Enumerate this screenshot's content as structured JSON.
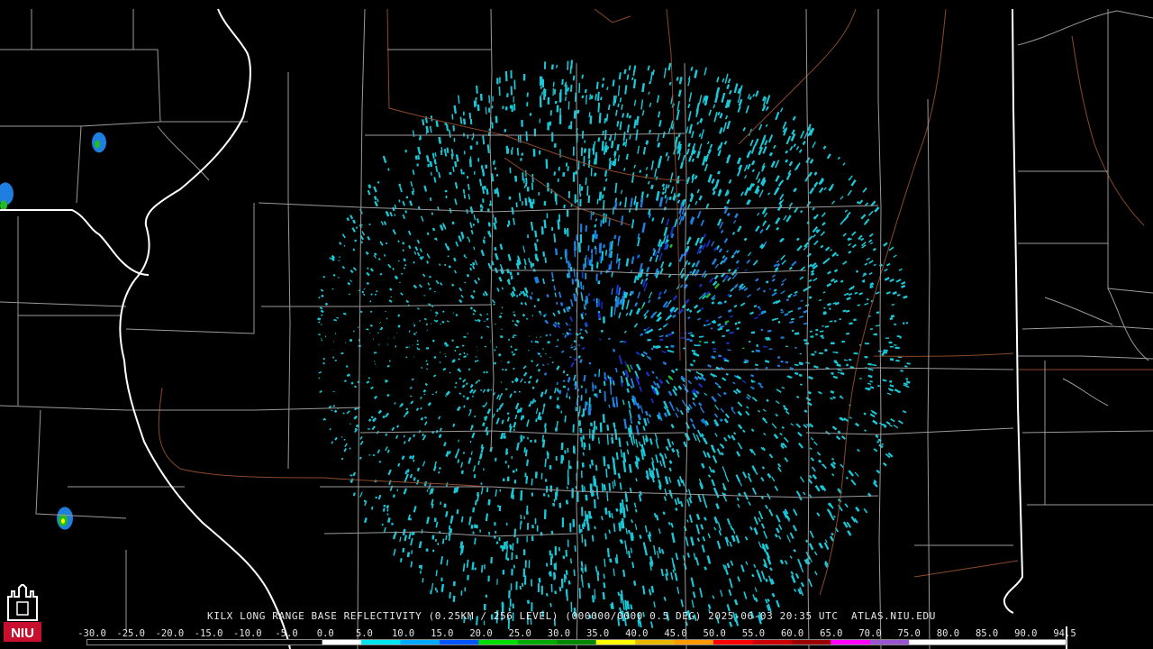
{
  "product": {
    "caption": "KILX LONG RANGE BASE REFLECTIVITY (0.25KM / 256 LEVEL) (000000/0000 0.5 DEG) 2025-06-03 20:35 UTC  ATLAS.NIU.EDU"
  },
  "logo": {
    "text": "NIU",
    "color": "#c8102e"
  },
  "scale": {
    "labels": [
      "-30.0",
      "-25.0",
      "-20.0",
      "-15.0",
      "-10.0",
      "-5.0",
      "0.0",
      "5.0",
      "10.0",
      "15.0",
      "20.0",
      "25.0",
      "30.0",
      "35.0",
      "40.0",
      "45.0",
      "50.0",
      "55.0",
      "60.0",
      "65.0",
      "70.0",
      "75.0",
      "80.0",
      "85.0",
      "90.0",
      "94.5"
    ],
    "colors": [
      "#000000",
      "#000000",
      "#000000",
      "#000000",
      "#000000",
      "#000000",
      "#ffffff",
      "#00e5ee",
      "#00aaff",
      "#0055ff",
      "#00dd00",
      "#00aa00",
      "#008800",
      "#ffff00",
      "#e6b800",
      "#ff9900",
      "#ff0000",
      "#cc0000",
      "#990000",
      "#ff00ff",
      "#9955cc",
      "#ffffff",
      "#ffffff",
      "#ffffff",
      "#ffffff"
    ]
  },
  "colors": {
    "state_border": "#ffffff",
    "county_border": "#9a9a9a",
    "highway": "#8b4a2b",
    "echo_light": "#18c8d8",
    "echo_mid": "#1e7fe0",
    "echo_strong": "#1830c8",
    "echo_green": "#22bb22"
  }
}
